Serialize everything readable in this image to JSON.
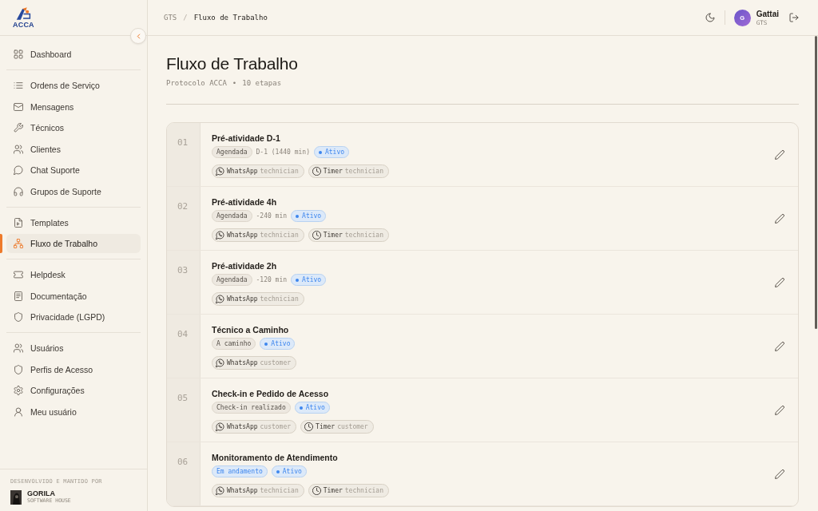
{
  "sidebar": {
    "brand": "ACCA",
    "groups": [
      {
        "items": [
          {
            "label": "Dashboard",
            "selected": false
          }
        ]
      },
      {
        "items": [
          {
            "label": "Ordens de Serviço",
            "selected": false
          },
          {
            "label": "Mensagens",
            "selected": false
          },
          {
            "label": "Técnicos",
            "selected": false
          },
          {
            "label": "Clientes",
            "selected": false
          },
          {
            "label": "Chat Suporte",
            "selected": false
          },
          {
            "label": "Grupos de Suporte",
            "selected": false
          }
        ]
      },
      {
        "items": [
          {
            "label": "Templates",
            "selected": false
          },
          {
            "label": "Fluxo de Trabalho",
            "selected": true
          }
        ]
      },
      {
        "items": [
          {
            "label": "Helpdesk",
            "selected": false
          },
          {
            "label": "Documentação",
            "selected": false
          },
          {
            "label": "Privacidade (LGPD)",
            "selected": false
          }
        ]
      },
      {
        "items": [
          {
            "label": "Usuários",
            "selected": false
          },
          {
            "label": "Perfis de Acesso",
            "selected": false
          },
          {
            "label": "Configurações",
            "selected": false
          },
          {
            "label": "Meu usuário",
            "selected": false
          }
        ]
      }
    ],
    "footer": {
      "credit": "DESENVOLVIDO E MANTIDO POR",
      "company": "GORILA",
      "tagline": "SOFTWARE HOUSE"
    }
  },
  "top_bar": {
    "breadcrumb": {
      "items": [
        "GTS",
        "Fluxo de Trabalho"
      ],
      "separator": "/"
    },
    "user": {
      "initial": "G",
      "name": "Gattai",
      "org": "GTS"
    }
  },
  "page": {
    "title": "Fluxo de Trabalho",
    "meta": [
      "Protocolo ACCA",
      "10 etapas"
    ],
    "meta_separator": "•"
  },
  "steps": [
    {
      "number": "01",
      "title": "Pré-atividade D-1",
      "trigger": {
        "label": "Agendada",
        "kind": "neutral"
      },
      "offset": "D-1 (1440 min)",
      "status": {
        "label": "Ativo",
        "active": true
      },
      "actions": [
        {
          "kind": "whatsapp",
          "label": "WhatsApp",
          "target": "technician"
        },
        {
          "kind": "timer",
          "label": "Timer",
          "target": "technician"
        }
      ]
    },
    {
      "number": "02",
      "title": "Pré-atividade 4h",
      "trigger": {
        "label": "Agendada",
        "kind": "neutral"
      },
      "offset": "-240 min",
      "status": {
        "label": "Ativo",
        "active": true
      },
      "actions": [
        {
          "kind": "whatsapp",
          "label": "WhatsApp",
          "target": "technician"
        },
        {
          "kind": "timer",
          "label": "Timer",
          "target": "technician"
        }
      ]
    },
    {
      "number": "03",
      "title": "Pré-atividade 2h",
      "trigger": {
        "label": "Agendada",
        "kind": "neutral"
      },
      "offset": "-120 min",
      "status": {
        "label": "Ativo",
        "active": true
      },
      "actions": [
        {
          "kind": "whatsapp",
          "label": "WhatsApp",
          "target": "technician"
        }
      ]
    },
    {
      "number": "04",
      "title": "Técnico a Caminho",
      "trigger": {
        "label": "A caminho",
        "kind": "neutral"
      },
      "status": {
        "label": "Ativo",
        "active": true
      },
      "actions": [
        {
          "kind": "whatsapp",
          "label": "WhatsApp",
          "target": "customer"
        }
      ]
    },
    {
      "number": "05",
      "title": "Check-in e Pedido de Acesso",
      "trigger": {
        "label": "Check-in realizado",
        "kind": "neutral"
      },
      "status": {
        "label": "Ativo",
        "active": true
      },
      "actions": [
        {
          "kind": "whatsapp",
          "label": "WhatsApp",
          "target": "customer"
        },
        {
          "kind": "timer",
          "label": "Timer",
          "target": "customer"
        }
      ]
    },
    {
      "number": "06",
      "title": "Monitoramento de Atendimento",
      "trigger": {
        "label": "Em andamento",
        "kind": "info"
      },
      "status": {
        "label": "Ativo",
        "active": true
      },
      "actions": [
        {
          "kind": "whatsapp",
          "label": "WhatsApp",
          "target": "technician"
        },
        {
          "kind": "timer",
          "label": "Timer",
          "target": "technician"
        }
      ]
    }
  ]
}
